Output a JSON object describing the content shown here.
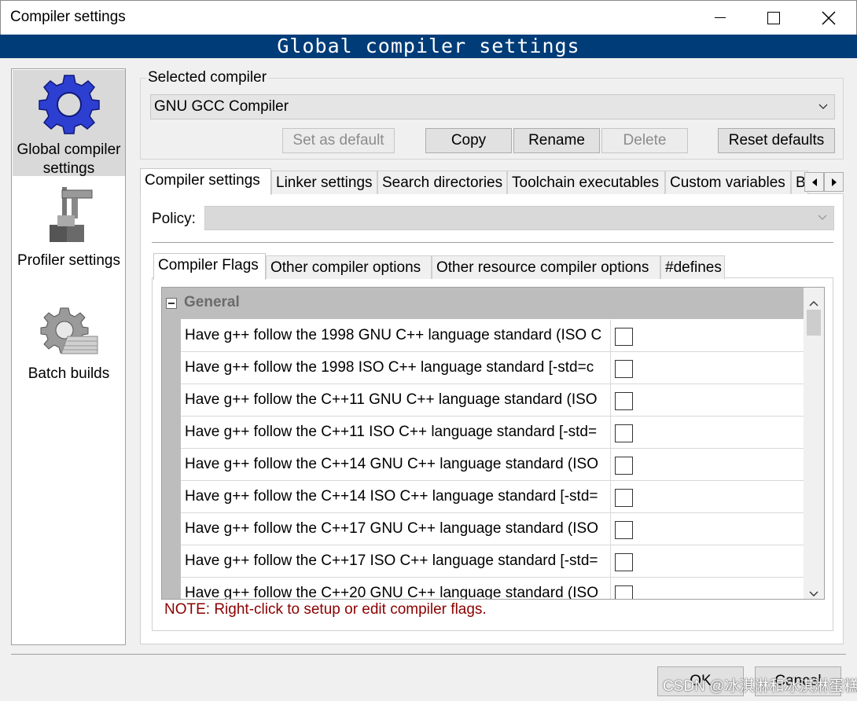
{
  "window": {
    "title": "Compiler settings",
    "banner": "Global compiler settings"
  },
  "nav": {
    "items": [
      {
        "label": "Global compiler settings",
        "icon": "gear-icon",
        "selected": true
      },
      {
        "label": "Profiler settings",
        "icon": "profiler-caliper-icon",
        "selected": false
      },
      {
        "label": "Batch builds",
        "icon": "batch-builds-gear-icon",
        "selected": false
      }
    ]
  },
  "selected_compiler": {
    "group_label": "Selected compiler",
    "value": "GNU GCC Compiler",
    "buttons": {
      "set_default": "Set as default",
      "copy": "Copy",
      "rename": "Rename",
      "delete": "Delete",
      "reset": "Reset defaults"
    }
  },
  "main_tabs": [
    "Compiler settings",
    "Linker settings",
    "Search directories",
    "Toolchain executables",
    "Custom variables",
    "B"
  ],
  "policy": {
    "label": "Policy:",
    "value": ""
  },
  "inner_tabs": [
    "Compiler Flags",
    "Other compiler options",
    "Other resource compiler options",
    "#defines"
  ],
  "flags": {
    "category": "General",
    "rows": [
      {
        "name": "Have g++ follow the 1998 GNU C++ language standard (ISO C",
        "checked": false
      },
      {
        "name": "Have g++ follow the 1998 ISO C++ language standard  [-std=c",
        "checked": false
      },
      {
        "name": "Have g++ follow the C++11 GNU C++ language standard (ISO",
        "checked": false
      },
      {
        "name": "Have g++ follow the C++11 ISO C++ language standard  [-std=",
        "checked": false
      },
      {
        "name": "Have g++ follow the C++14 GNU C++ language standard (ISO",
        "checked": false
      },
      {
        "name": "Have g++ follow the C++14 ISO C++ language standard  [-std=",
        "checked": false
      },
      {
        "name": "Have g++ follow the C++17 GNU C++ language standard (ISO",
        "checked": false
      },
      {
        "name": "Have g++ follow the C++17 ISO C++ language standard  [-std=",
        "checked": false
      },
      {
        "name": "Have g++ follow the C++20 GNU C++ language standard (ISO",
        "checked": false
      }
    ]
  },
  "note": "NOTE: Right-click to setup or edit compiler flags.",
  "footer": {
    "ok": "OK",
    "cancel": "Cancel"
  },
  "watermark": "CSDN @冰淇淋和冰淇淋蛋糕"
}
